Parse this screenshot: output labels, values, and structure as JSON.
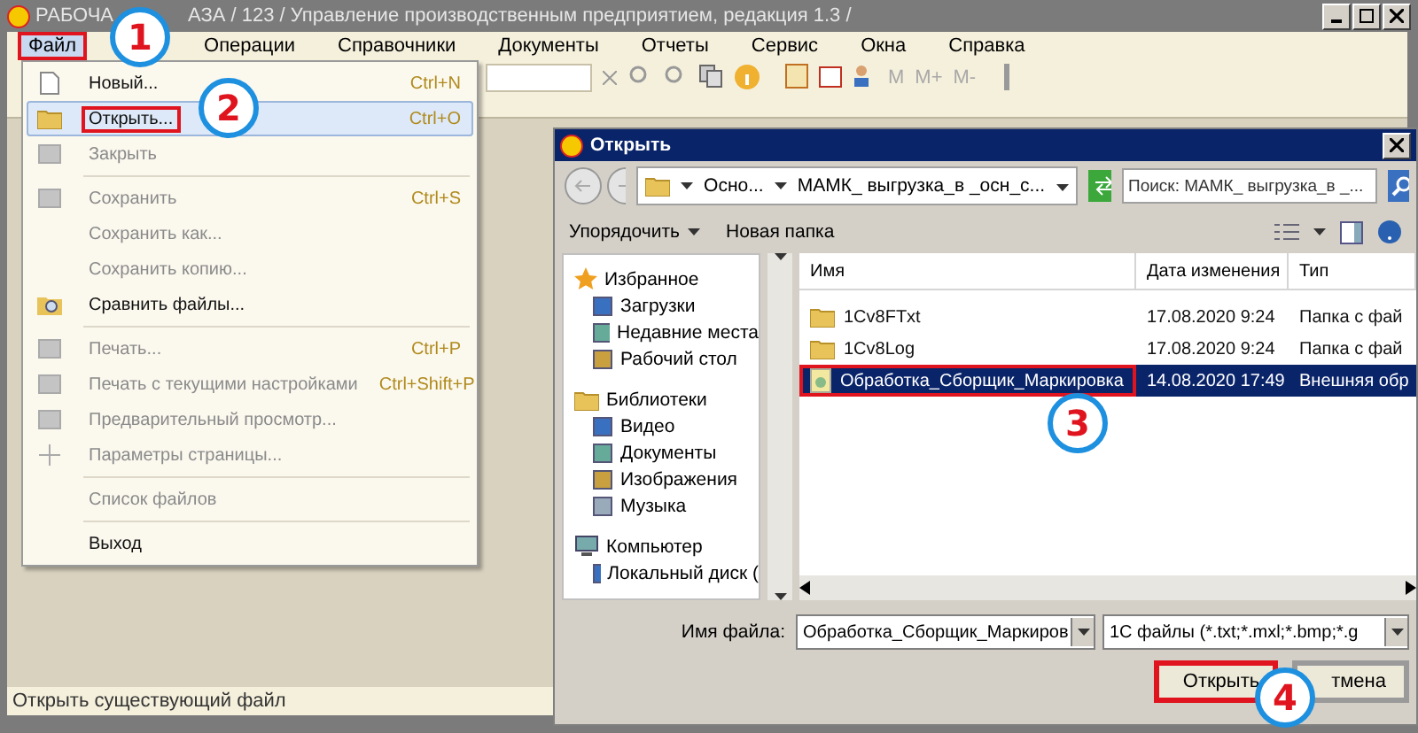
{
  "window": {
    "title_parts": [
      "РАБОЧА",
      "АЗА / 123 / Управление производственным предприятием, редакция 1.3 /"
    ]
  },
  "menu_bar": [
    {
      "label": "Файл",
      "selected": true,
      "highlighted": true
    },
    {
      "label": "Операции",
      "selected": false,
      "highlighted": false
    },
    {
      "label": "Справочники",
      "selected": false,
      "highlighted": false
    },
    {
      "label": "Документы",
      "selected": false,
      "highlighted": false
    },
    {
      "label": "Отчеты",
      "selected": false,
      "highlighted": false
    },
    {
      "label": "Сервис",
      "selected": false,
      "highlighted": false
    },
    {
      "label": "Окна",
      "selected": false,
      "highlighted": false
    },
    {
      "label": "Справка",
      "selected": false,
      "highlighted": false
    }
  ],
  "toolbar": {
    "memory_buttons": [
      {
        "label": "M",
        "disabled": true
      },
      {
        "label": "M+",
        "disabled": true
      },
      {
        "label": "M-",
        "disabled": true
      }
    ]
  },
  "file_menu": [
    {
      "kind": "item",
      "label": "Новый...",
      "shortcut": "Ctrl+N",
      "disabled": false,
      "selected": false,
      "highlighted": false
    },
    {
      "kind": "item",
      "label": "Открыть...",
      "shortcut": "Ctrl+O",
      "disabled": false,
      "selected": true,
      "highlighted": true
    },
    {
      "kind": "item",
      "label": "Закрыть",
      "disabled": true,
      "selected": false,
      "highlighted": false
    },
    {
      "kind": "separator"
    },
    {
      "kind": "item",
      "label": "Сохранить",
      "shortcut": "Ctrl+S",
      "disabled": true,
      "selected": false,
      "highlighted": false
    },
    {
      "kind": "item",
      "label": "Сохранить как...",
      "disabled": true,
      "selected": false,
      "highlighted": false
    },
    {
      "kind": "item",
      "label": "Сохранить копию...",
      "disabled": true,
      "selected": false,
      "highlighted": false
    },
    {
      "kind": "item",
      "label": "Сравнить файлы...",
      "disabled": false,
      "selected": false,
      "highlighted": false
    },
    {
      "kind": "separator"
    },
    {
      "kind": "item",
      "label": "Печать...",
      "shortcut": "Ctrl+P",
      "disabled": true,
      "selected": false,
      "highlighted": false
    },
    {
      "kind": "item",
      "label": "Печать с текущими настройками",
      "shortcut": "Ctrl+Shift+P",
      "disabled": true,
      "selected": false,
      "highlighted": false
    },
    {
      "kind": "item",
      "label": "Предварительный просмотр...",
      "disabled": true,
      "selected": false,
      "highlighted": false
    },
    {
      "kind": "item",
      "label": "Параметры страницы...",
      "disabled": true,
      "selected": false,
      "highlighted": false
    },
    {
      "kind": "separator"
    },
    {
      "kind": "item",
      "label": "Список файлов",
      "disabled": true,
      "selected": false,
      "highlighted": false
    },
    {
      "kind": "separator"
    },
    {
      "kind": "item",
      "label": "Выход",
      "disabled": false,
      "selected": false,
      "highlighted": false
    }
  ],
  "status_bar": "Открыть существующий файл",
  "dialog": {
    "title": "Открыть",
    "breadcrumbs": [
      "Осно...",
      "МАМК_ выгрузка_в _осн_с..."
    ],
    "search": {
      "placeholder": "Поиск: МАМК_ выгрузка_в _..."
    },
    "commands": [
      {
        "label": "Упорядочить",
        "dropdown": true
      },
      {
        "label": "Новая папка",
        "dropdown": false
      }
    ],
    "nav": [
      {
        "label": "Избранное",
        "children": [
          {
            "label": "Загрузки"
          },
          {
            "label": "Недавние места"
          },
          {
            "label": "Рабочий стол"
          }
        ]
      },
      {
        "label": "Библиотеки",
        "children": [
          {
            "label": "Видео"
          },
          {
            "label": "Документы"
          },
          {
            "label": "Изображения"
          },
          {
            "label": "Музыка"
          }
        ]
      },
      {
        "label": "Компьютер",
        "children": [
          {
            "label": "Локальный диск ("
          }
        ]
      }
    ],
    "columns": [
      "Имя",
      "Дата изменения",
      "Тип"
    ],
    "rows": [
      {
        "kind": "folder",
        "cells": [
          "1Cv8FTxt",
          "17.08.2020 9:24",
          "Папка с фай"
        ],
        "selected": false,
        "highlighted": false
      },
      {
        "kind": "folder",
        "cells": [
          "1Cv8Log",
          "17.08.2020 9:24",
          "Папка с фай"
        ],
        "selected": false,
        "highlighted": false
      },
      {
        "kind": "file",
        "cells": [
          "Обработка_Сборщик_Маркировка",
          "14.08.2020 17:49",
          "Внешняя обр"
        ],
        "selected": true,
        "highlighted": true
      }
    ],
    "filename_label": "Имя файла:",
    "filename": "Обработка_Сборщик_Маркиров",
    "filter": "1С файлы (*.txt;*.mxl;*.bmp;*.g",
    "buttons": [
      {
        "label": "Открыть",
        "highlighted": true
      },
      {
        "label": "тмена",
        "highlighted": false
      }
    ]
  },
  "callouts": [
    "1",
    "2",
    "3",
    "4"
  ]
}
